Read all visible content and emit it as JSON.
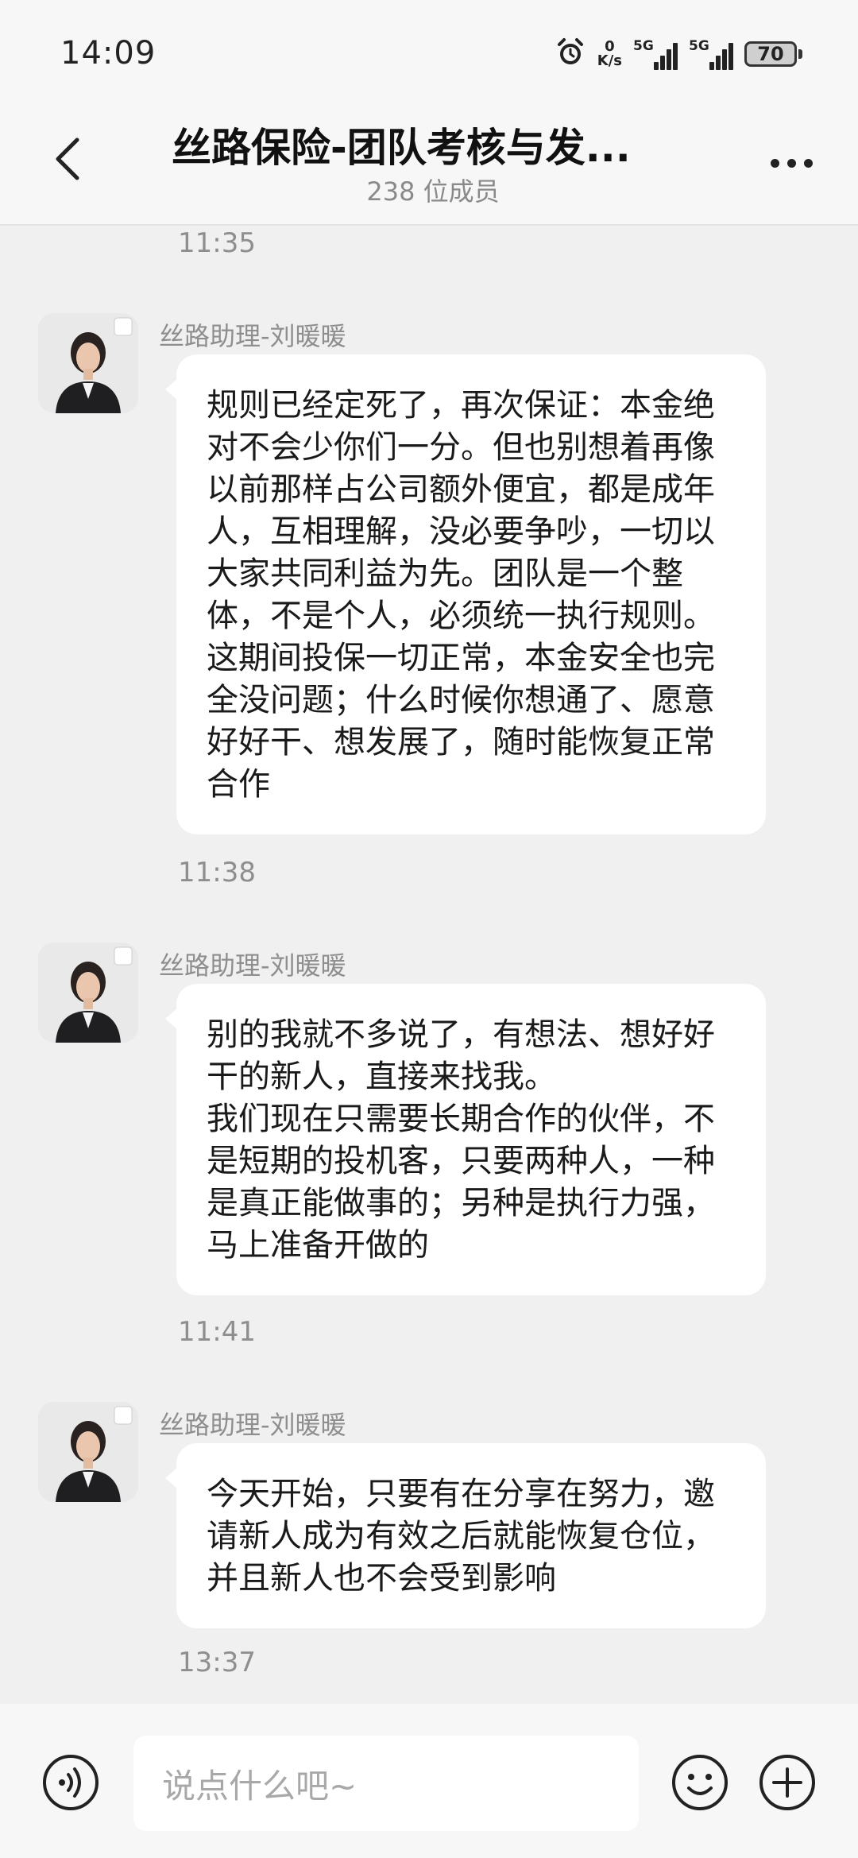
{
  "status_bar": {
    "time": "14:09",
    "net_speed_value": "0",
    "net_speed_unit": "K/s",
    "sim1_tag": "5G",
    "sim2_tag": "5G",
    "battery": "70",
    "icons": [
      "alarm-icon",
      "signal-icon",
      "battery-icon"
    ]
  },
  "header": {
    "title": "丝路保险-团队考核与发...",
    "member_count": "238 位成员",
    "icons": [
      "back-arrow-icon",
      "more-dots-icon"
    ]
  },
  "messages": [
    {
      "timestamp_above": "11:35",
      "sender": "丝路助理-刘暖暖",
      "text": "规则已经定死了，再次保证：本金绝对不会少你们一分。但也别想着再像以前那样占公司额外便宜，都是成年人，互相理解，没必要争吵，一切以大家共同利益为先。团队是一个整体，不是个人，必须统一执行规则。这期间投保一切正常，本金安全也完全没问题；什么时候你想通了、愿意好好干、想发展了，随时能恢复正常合作"
    },
    {
      "timestamp_above": "11:38",
      "sender": "丝路助理-刘暖暖",
      "text": "别的我就不多说了，有想法、想好好干的新人，直接来找我。\n我们现在只需要长期合作的伙伴，不是短期的投机客，只要两种人，一种是真正能做事的；另种是执行力强，马上准备开做的"
    },
    {
      "timestamp_above": "11:41",
      "sender": "丝路助理-刘暖暖",
      "text": "今天开始，只要有在分享在努力，邀请新人成为有效之后就能恢复仓位，并且新人也不会受到影响"
    }
  ],
  "last_timestamp": "13:37",
  "input_bar": {
    "placeholder": "说点什么吧~",
    "icons": [
      "voice-icon",
      "emoji-icon",
      "plus-icon"
    ]
  },
  "colors": {
    "background": "#f0f0f0",
    "bubble": "#ffffff",
    "meta_text": "#8e8e8e"
  }
}
